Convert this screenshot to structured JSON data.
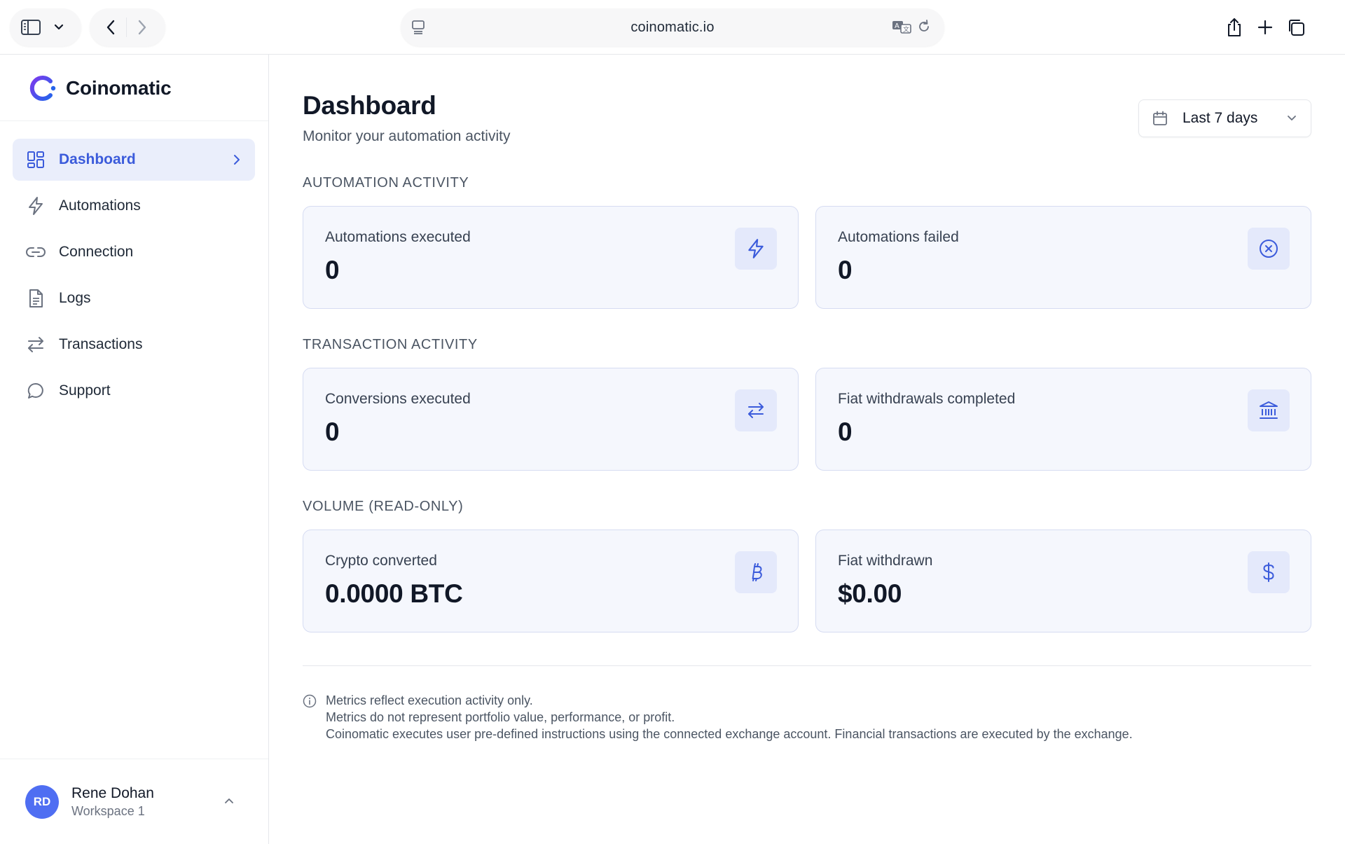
{
  "browser": {
    "url": "coinomatic.io"
  },
  "brand": {
    "name": "Coinomatic",
    "accent": "#4f6ef2"
  },
  "sidebar": {
    "items": [
      {
        "label": "Dashboard",
        "icon": "layout-grid-icon",
        "active": true
      },
      {
        "label": "Automations",
        "icon": "lightning-icon",
        "active": false
      },
      {
        "label": "Connection",
        "icon": "link-icon",
        "active": false
      },
      {
        "label": "Logs",
        "icon": "document-icon",
        "active": false
      },
      {
        "label": "Transactions",
        "icon": "arrows-left-right-icon",
        "active": false
      },
      {
        "label": "Support",
        "icon": "chat-bubble-icon",
        "active": false
      }
    ],
    "user": {
      "initials": "RD",
      "name": "Rene Dohan",
      "workspace": "Workspace 1"
    }
  },
  "header": {
    "title": "Dashboard",
    "subtitle": "Monitor your automation activity",
    "range": "Last 7 days"
  },
  "sections": [
    {
      "title": "AUTOMATION ACTIVITY",
      "cards": [
        {
          "label": "Automations executed",
          "value": "0",
          "icon": "lightning-icon"
        },
        {
          "label": "Automations failed",
          "value": "0",
          "icon": "x-circle-icon"
        }
      ]
    },
    {
      "title": "TRANSACTION ACTIVITY",
      "cards": [
        {
          "label": "Conversions executed",
          "value": "0",
          "icon": "arrows-left-right-icon"
        },
        {
          "label": "Fiat withdrawals completed",
          "value": "0",
          "icon": "bank-icon"
        }
      ]
    },
    {
      "title": "VOLUME (READ-ONLY)",
      "cards": [
        {
          "label": "Crypto converted",
          "value": "0.0000 BTC",
          "icon": "bitcoin-icon"
        },
        {
          "label": "Fiat withdrawn",
          "value": "$0.00",
          "icon": "dollar-icon"
        }
      ]
    }
  ],
  "notes": [
    "Metrics reflect execution activity only.",
    "Metrics do not represent portfolio value, performance, or profit.",
    "Coinomatic executes user pre-defined instructions using the connected exchange account. Financial transactions are executed by the exchange."
  ]
}
